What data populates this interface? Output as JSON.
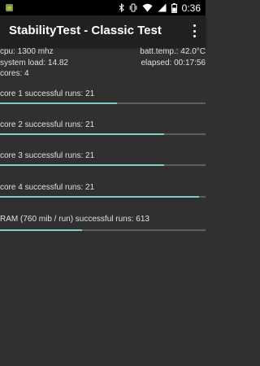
{
  "status_bar": {
    "time": "0:36",
    "icons": [
      "android-icon",
      "bluetooth-icon",
      "vibrate-icon",
      "wifi-icon",
      "signal-icon",
      "battery-icon"
    ]
  },
  "app_bar": {
    "title": "StabilityTest - Classic Test",
    "overflow_icon": "more-vert-icon",
    "background": "#212121"
  },
  "stats": {
    "cpu": "cpu: 1300 mhz",
    "batt_temp": "batt.temp.: 42.0°C",
    "system_load": "system load: 14.82",
    "elapsed": "elapsed: 00:17:56",
    "cores": "cores: 4"
  },
  "tests": [
    {
      "label": "core 1 successful runs: 21",
      "progress": 0.57
    },
    {
      "label": "core 2 successful runs: 21",
      "progress": 0.8
    },
    {
      "label": "core 3 successful runs: 21",
      "progress": 0.8
    },
    {
      "label": "core 4 successful runs: 21",
      "progress": 0.97
    },
    {
      "label": "RAM (760 mib / run) successful runs: 613",
      "progress": 0.4
    }
  ],
  "colors": {
    "background": "#303030",
    "progress_fill": "#80cbc4",
    "progress_track": "#5e5e5e"
  }
}
